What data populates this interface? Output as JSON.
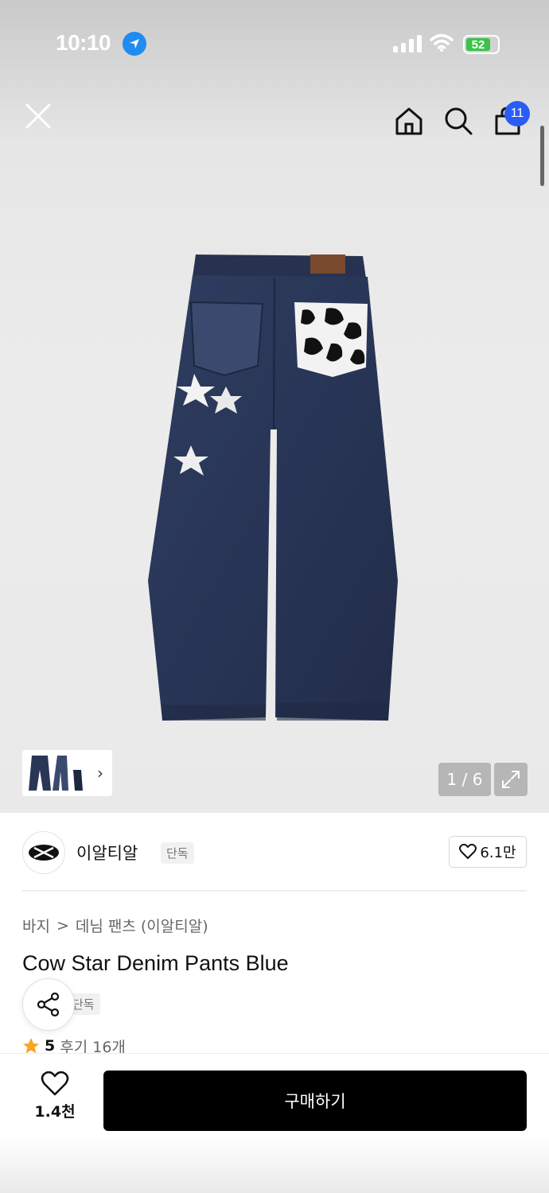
{
  "status_bar": {
    "time": "10:10",
    "battery_percent": "52",
    "location_icon": "location-arrow-icon",
    "signal_icon": "cellular-signal-icon",
    "wifi_icon": "wifi-icon"
  },
  "top_nav": {
    "close_icon": "close-icon",
    "home_icon": "home-icon",
    "search_icon": "search-icon",
    "cart_icon": "shopping-bag-icon",
    "cart_count": "11",
    "accent_color": "#2b5cf6"
  },
  "gallery": {
    "counter": "1 / 6",
    "expand_icon": "expand-icon",
    "thumbnail_more_icon": "chevron-right-icon"
  },
  "brand": {
    "name": "이알티알",
    "badge": "단독",
    "likes": "6.1만",
    "like_icon": "heart-outline-icon"
  },
  "product": {
    "breadcrumb": [
      "바지",
      "데님 팬츠 (이알티알)"
    ],
    "breadcrumb_separator": ">",
    "title": "Cow Star Denim Pants Blue",
    "tag": "단독",
    "rating": "5",
    "reviews": "후기 16개",
    "star_color": "#f5a623"
  },
  "bottom_bar": {
    "wish_count": "1.4천",
    "buy_label": "구매하기",
    "share_icon": "share-icon"
  }
}
